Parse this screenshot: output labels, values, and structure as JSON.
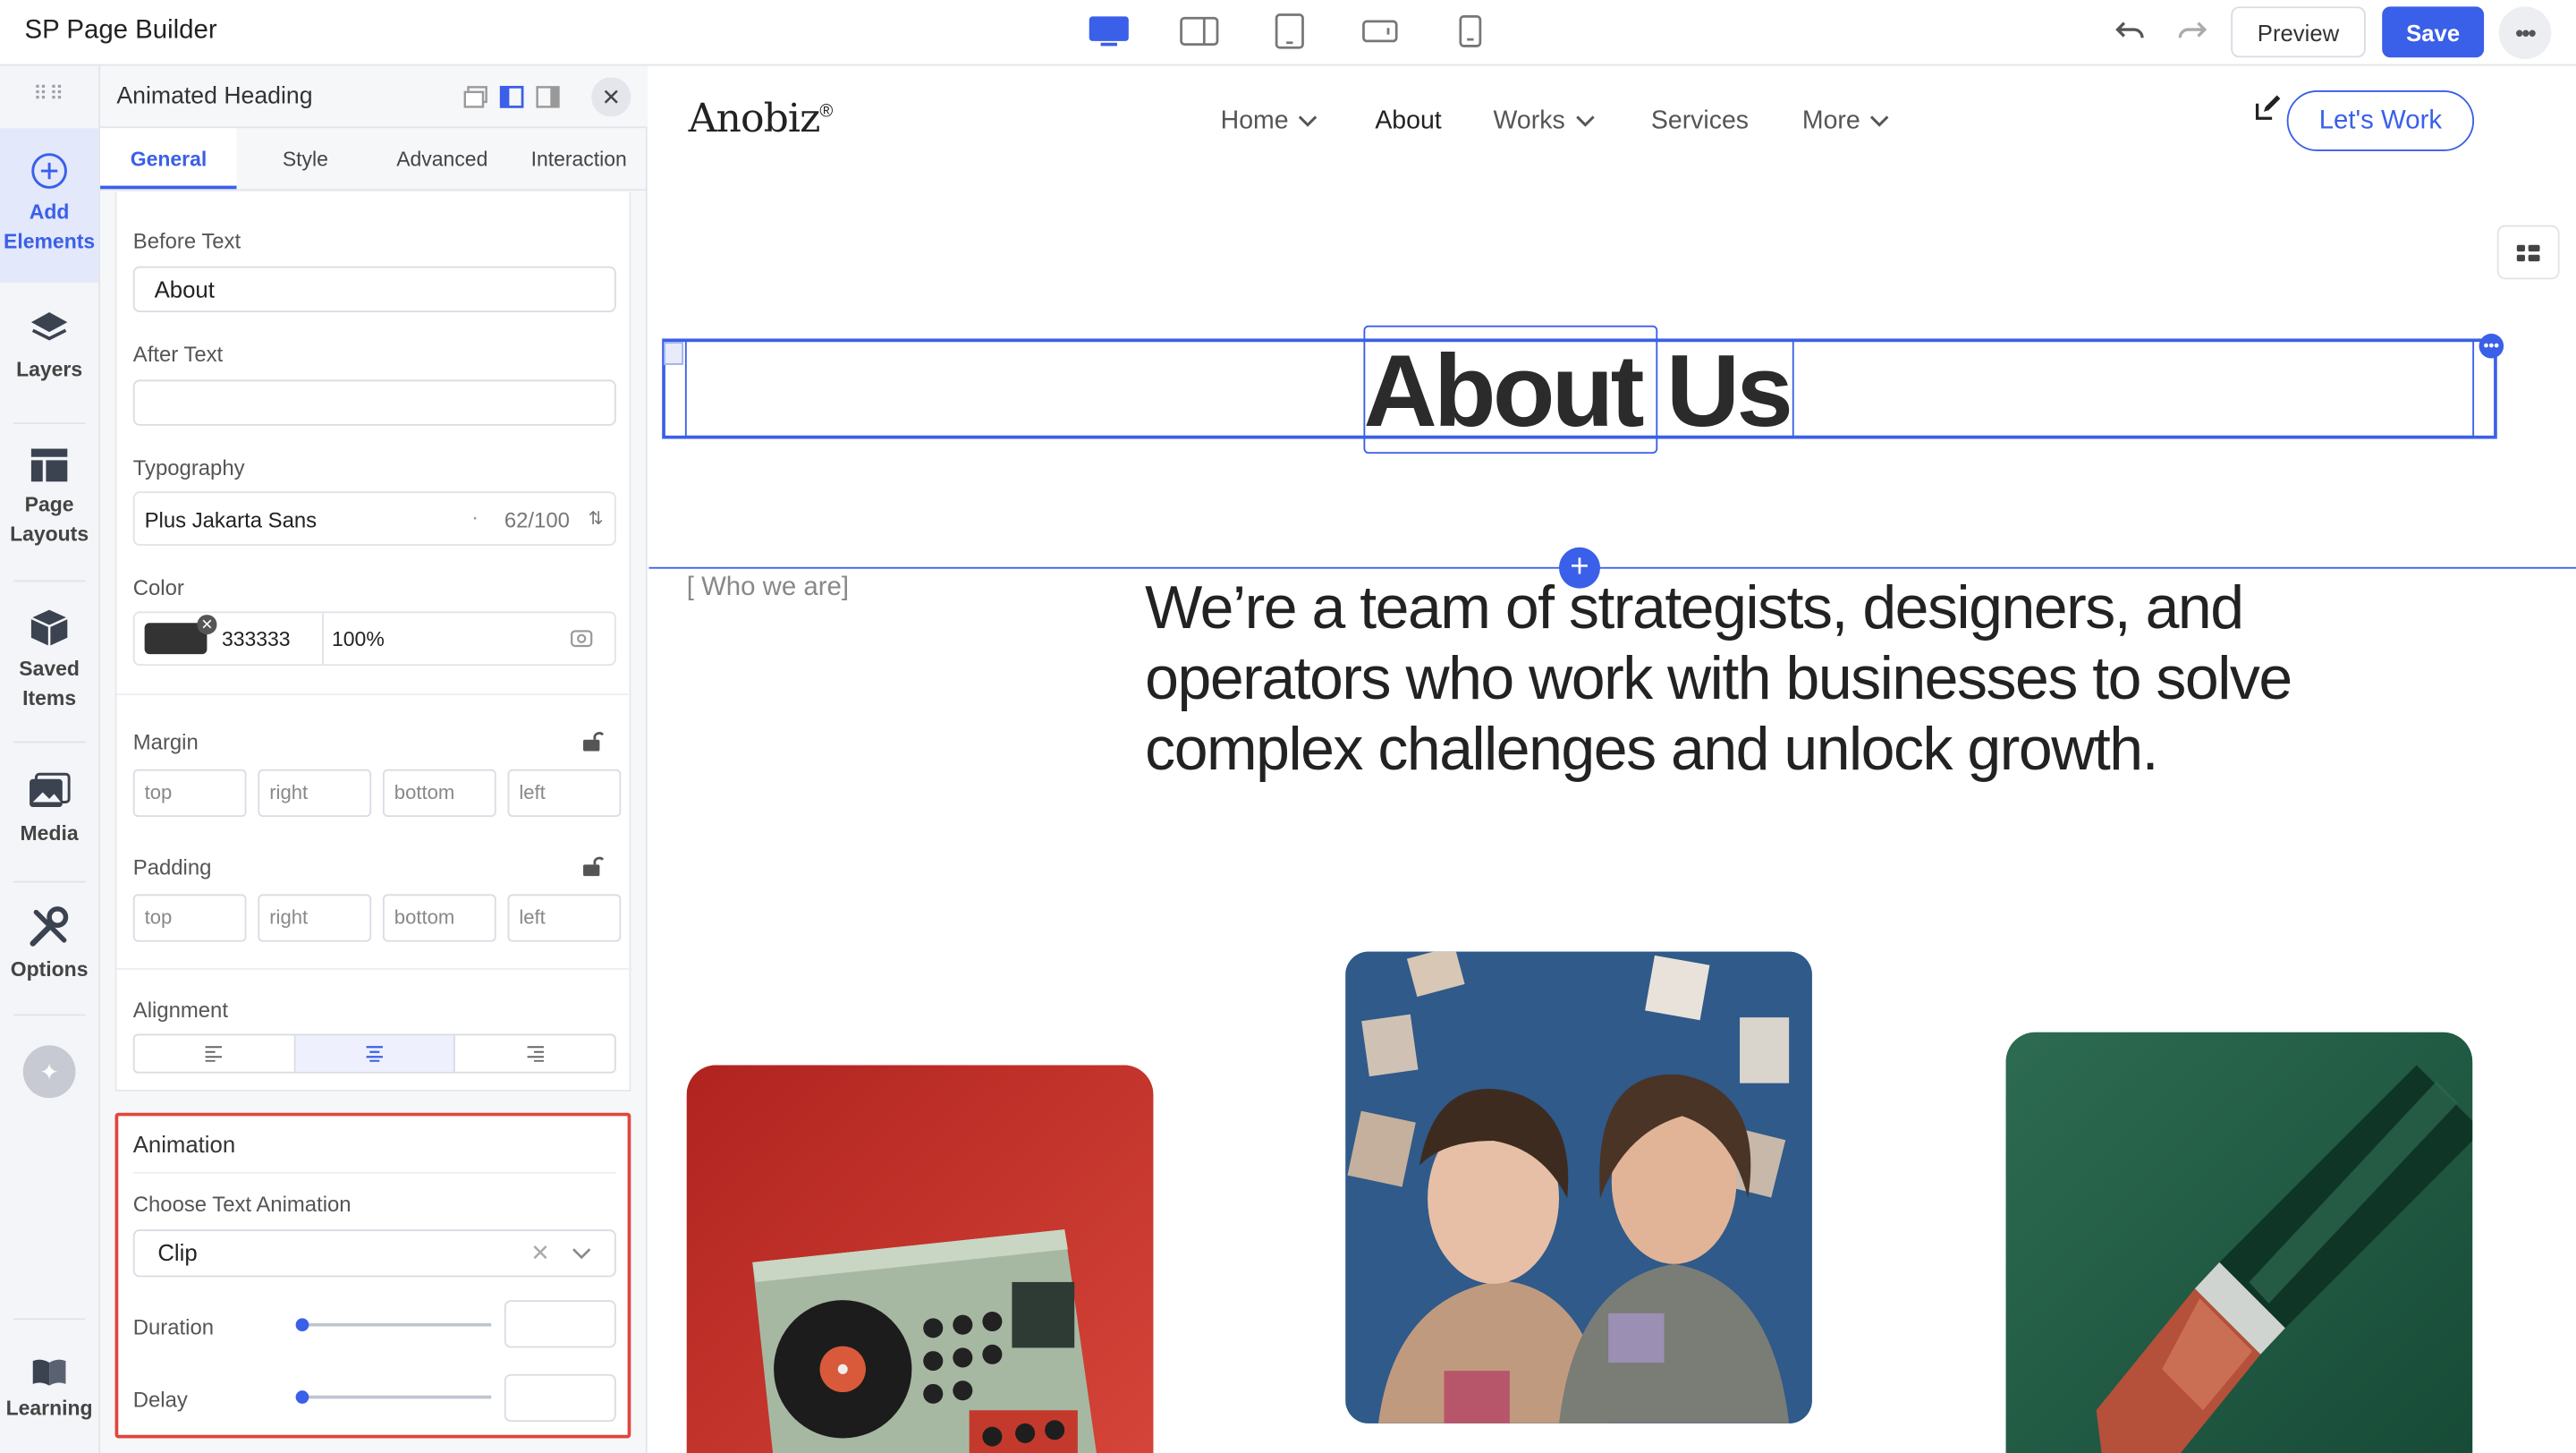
{
  "app": {
    "title": "SP Page Builder"
  },
  "toolbar": {
    "preview_label": "Preview",
    "save_label": "Save",
    "accent_color": "#3a5fe8"
  },
  "rail": {
    "items": [
      {
        "label_line1": "Add",
        "label_line2": "Elements",
        "icon": "plus-circle-icon",
        "active": true
      },
      {
        "label_line1": "Layers",
        "label_line2": "",
        "icon": "layers-icon"
      },
      {
        "label_line1": "Page",
        "label_line2": "Layouts",
        "icon": "page-layouts-icon"
      },
      {
        "label_line1": "Saved",
        "label_line2": "Items",
        "icon": "saved-items-icon"
      },
      {
        "label_line1": "Media",
        "label_line2": "",
        "icon": "media-icon"
      },
      {
        "label_line1": "Options",
        "label_line2": "",
        "icon": "options-icon"
      },
      {
        "label_line1": "Learning",
        "label_line2": "",
        "icon": "book-icon"
      }
    ]
  },
  "panel": {
    "title": "Animated Heading",
    "tabs": [
      "General",
      "Style",
      "Advanced",
      "Interaction"
    ],
    "before_text_label": "Before Text",
    "before_text_value": "About",
    "after_text_label": "After Text",
    "after_text_value": "",
    "typography_label": "Typography",
    "font_name": "Plus Jakarta Sans",
    "font_weight": "62/100",
    "color_label": "Color",
    "color_hex": "333333",
    "color_opacity": "100%",
    "margin_label": "Margin",
    "padding_label": "Padding",
    "box_placeholders": [
      "top",
      "right",
      "bottom",
      "left"
    ],
    "alignment_label": "Alignment",
    "animation": {
      "title": "Animation",
      "choose_label": "Choose Text Animation",
      "selected": "Clip",
      "duration_label": "Duration",
      "delay_label": "Delay",
      "duration_level": 0,
      "delay_level": 0
    }
  },
  "site": {
    "logo": "Anobiz",
    "logo_mark": "®",
    "nav": [
      "Home",
      "About",
      "Works",
      "Services",
      "More"
    ],
    "cta": "Let's Work",
    "heading": "About Us",
    "eyebrow": "[ Who we are]",
    "paragraph": "We’re a team of strategists, designers, and operators who work with businesses to solve complex challenges and unlock growth."
  }
}
